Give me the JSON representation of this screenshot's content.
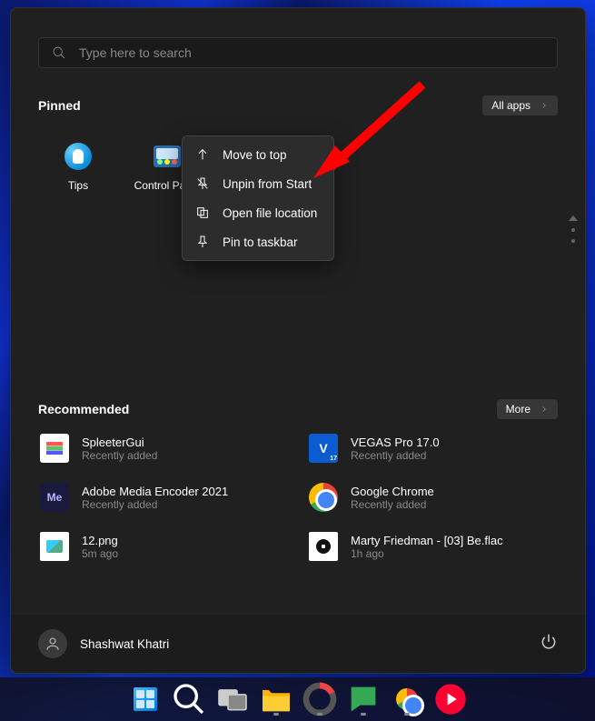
{
  "search": {
    "placeholder": "Type here to search"
  },
  "pinned": {
    "title": "Pinned",
    "all_apps_label": "All apps",
    "items": [
      {
        "label": "Tips"
      },
      {
        "label": "Control Panel"
      }
    ]
  },
  "context_menu": {
    "items": [
      {
        "label": "Move to top"
      },
      {
        "label": "Unpin from Start"
      },
      {
        "label": "Open file location"
      },
      {
        "label": "Pin to taskbar"
      }
    ]
  },
  "recommended": {
    "title": "Recommended",
    "more_label": "More",
    "items": [
      {
        "name": "SpleeterGui",
        "sub": "Recently added"
      },
      {
        "name": "VEGAS Pro 17.0",
        "sub": "Recently added"
      },
      {
        "name": "Adobe Media Encoder 2021",
        "sub": "Recently added"
      },
      {
        "name": "Google Chrome",
        "sub": "Recently added"
      },
      {
        "name": "12.png",
        "sub": "5m ago"
      },
      {
        "name": "Marty Friedman - [03] Be.flac",
        "sub": "1h ago"
      }
    ]
  },
  "footer": {
    "user_name": "Shashwat Khatri"
  }
}
